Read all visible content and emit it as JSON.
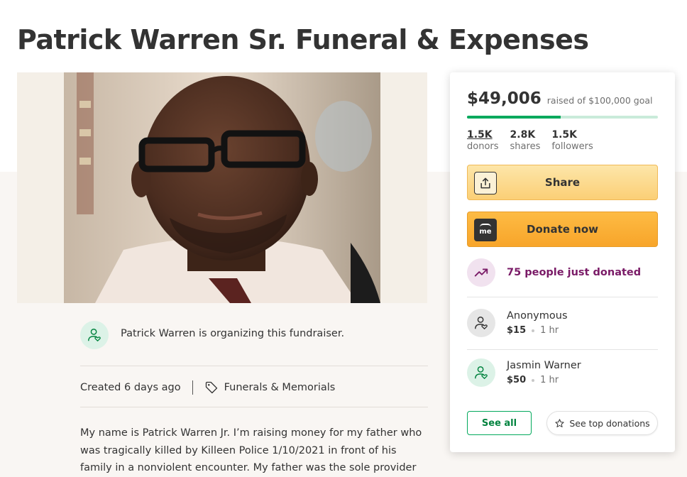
{
  "campaign": {
    "title": "Patrick Warren Sr. Funeral & Expenses",
    "organizer_text": "Patrick Warren is organizing this fundraiser.",
    "created": "Created 6 days ago",
    "category": "Funerals & Memorials",
    "story": "My name is Patrick Warren Jr. I’m raising money for my father who was tragically killed by Killeen Police 1/10/2021 in front of his family in a nonviolent encounter. My father was the sole provider for his family. He"
  },
  "donation_card": {
    "raised": "$49,006",
    "goal_text": "raised of $100,000 goal",
    "progress_fraction": 0.49,
    "stats": [
      {
        "value": "1.5K",
        "label": "donors"
      },
      {
        "value": "2.8K",
        "label": "shares"
      },
      {
        "value": "1.5K",
        "label": "followers"
      }
    ],
    "share_label": "Share",
    "donate_label": "Donate now",
    "donate_icon_text": "me",
    "trend_text": "75 people just donated",
    "donors": [
      {
        "name": "Anonymous",
        "amount": "$15",
        "time": "1 hr"
      },
      {
        "name": "Jasmin Warner",
        "amount": "$50",
        "time": "1 hr"
      }
    ],
    "see_all_label": "See all",
    "see_top_label": "See top donations"
  },
  "colors": {
    "accent_green": "#02a95c",
    "progress_track": "#c9ebda",
    "trend_purple": "#7a1b67",
    "donate_orange": "#f8a52a",
    "share_yellow": "#fbcf76"
  },
  "icons": {
    "organizer": "user-heart-icon",
    "category": "tag-icon",
    "share": "upload-share-icon",
    "donate": "gofundme-logo-icon",
    "trend": "trending-up-icon",
    "donor": "user-heart-icon",
    "see_top": "star-icon"
  }
}
